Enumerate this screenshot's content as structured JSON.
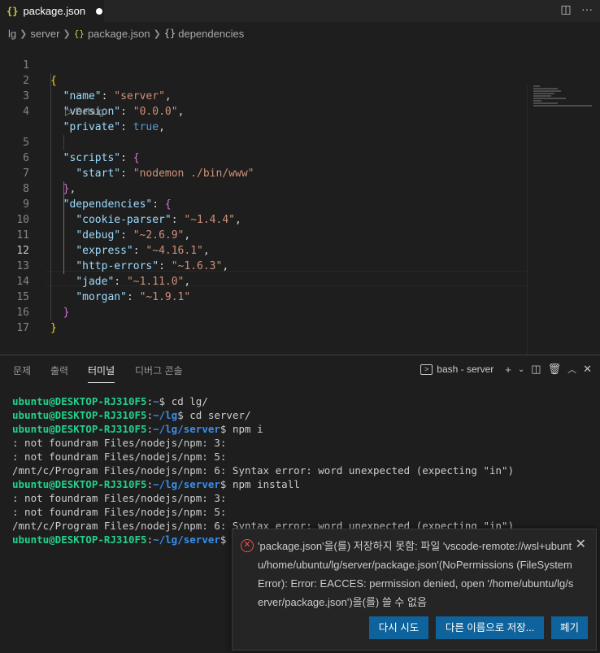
{
  "tab": {
    "title": "package.json",
    "icon": "json-braces-icon"
  },
  "tab_actions": {
    "split": "◫",
    "more": "···"
  },
  "breadcrumb": [
    "lg",
    "server",
    "package.json",
    "dependencies"
  ],
  "editor": {
    "lines": [
      "1",
      "2",
      "3",
      "4",
      "5",
      "6",
      "7",
      "8",
      "9",
      "10",
      "11",
      "12",
      "13",
      "14",
      "15",
      "16",
      "17"
    ],
    "active_line": "12",
    "codelens": "▷ Debug",
    "name_key": "\"name\"",
    "name_val": "\"server\"",
    "version_key": "\"version\"",
    "version_val": "\"0.0.0\"",
    "private_key": "\"private\"",
    "private_val": "true",
    "scripts_key": "\"scripts\"",
    "start_key": "\"start\"",
    "start_val": "\"nodemon ./bin/www\"",
    "deps_key": "\"dependencies\"",
    "deps": [
      {
        "k": "\"cookie-parser\"",
        "v": "\"~1.4.4\""
      },
      {
        "k": "\"debug\"",
        "v": "\"~2.6.9\""
      },
      {
        "k": "\"express\"",
        "v": "\"~4.16.1\""
      },
      {
        "k": "\"http-errors\"",
        "v": "\"~1.6.3\""
      },
      {
        "k": "\"jade\"",
        "v": "\"~1.11.0\""
      },
      {
        "k": "\"morgan\"",
        "v": "\"~1.9.1\""
      }
    ]
  },
  "panel": {
    "tabs": [
      "문제",
      "출력",
      "터미널",
      "디버그 콘솔"
    ],
    "active_tab": "터미널",
    "terminal_name": "bash - server"
  },
  "terminal": {
    "user": "ubuntu@DESKTOP-RJ310F5",
    "lines": [
      {
        "path": "~",
        "cmd": "cd lg/"
      },
      {
        "path": "~/lg",
        "cmd": "cd server/"
      },
      {
        "path": "~/lg/server",
        "cmd": "npm i"
      },
      {
        "text": ": not foundram Files/nodejs/npm: 3:"
      },
      {
        "text": ": not foundram Files/nodejs/npm: 5:"
      },
      {
        "text": "/mnt/c/Program Files/nodejs/npm: 6: Syntax error: word unexpected (expecting \"in\")"
      },
      {
        "path": "~/lg/server",
        "cmd": "npm install"
      },
      {
        "text": ": not foundram Files/nodejs/npm: 3:"
      },
      {
        "text": ": not foundram Files/nodejs/npm: 5:"
      },
      {
        "text": "/mnt/c/Program Files/nodejs/npm: 6: Syntax error: word unexpected (expecting \"in\")"
      },
      {
        "path": "~/lg/server",
        "cmd": ""
      }
    ]
  },
  "notification": {
    "message": "'package.json'을(를) 저장하지 못함: 파일 'vscode-remote://wsl+ubuntu/home/ubuntu/lg/server/package.json'(NoPermissions (FileSystemError): Error: EACCES: permission denied, open '/home/ubuntu/lg/server/package.json')을(를) 쓸 수 없음",
    "buttons": [
      "다시 시도",
      "다른 이름으로 저장...",
      "폐기"
    ],
    "close": "✕"
  },
  "colors": {
    "accent": "#0e639c",
    "error": "#f14c4c",
    "string": "#ce9178",
    "key": "#9cdcfe"
  }
}
